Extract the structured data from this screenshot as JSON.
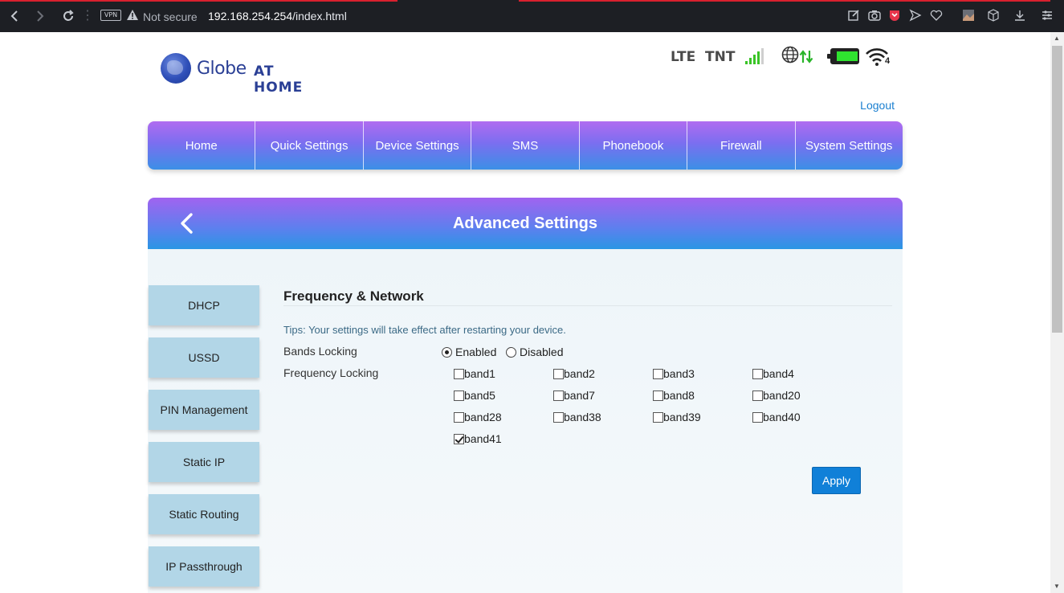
{
  "browser": {
    "vpn_label": "VPN",
    "security_text": "Not secure",
    "url_host": "192.168.254.254",
    "url_path": "/index.html"
  },
  "header": {
    "brand": "Globe",
    "brand_sub": "AT HOME",
    "network_type": "LTE",
    "operator": "TNT",
    "wifi_clients": "4",
    "logout": "Logout"
  },
  "nav": {
    "items": [
      {
        "label": "Home"
      },
      {
        "label": "Quick Settings"
      },
      {
        "label": "Device Settings"
      },
      {
        "label": "SMS"
      },
      {
        "label": "Phonebook"
      },
      {
        "label": "Firewall"
      },
      {
        "label": "System Settings"
      }
    ]
  },
  "section": {
    "title": "Advanced Settings"
  },
  "side_menu": {
    "items": [
      {
        "label": "DHCP"
      },
      {
        "label": "USSD"
      },
      {
        "label": "PIN Management"
      },
      {
        "label": "Static IP"
      },
      {
        "label": "Static Routing"
      },
      {
        "label": "IP Passthrough"
      }
    ]
  },
  "panel": {
    "title": "Frequency & Network",
    "tips": "Tips: Your settings will take effect after restarting your device.",
    "bands_locking_label": "Bands Locking",
    "enabled_label": "Enabled",
    "disabled_label": "Disabled",
    "bands_locking_value": "Enabled",
    "frequency_locking_label": "Frequency Locking",
    "bands": [
      {
        "label": "band1",
        "checked": false
      },
      {
        "label": "band2",
        "checked": false
      },
      {
        "label": "band3",
        "checked": false
      },
      {
        "label": "band4",
        "checked": false
      },
      {
        "label": "band5",
        "checked": false
      },
      {
        "label": "band7",
        "checked": false
      },
      {
        "label": "band8",
        "checked": false
      },
      {
        "label": "band20",
        "checked": false
      },
      {
        "label": "band28",
        "checked": false
      },
      {
        "label": "band38",
        "checked": false
      },
      {
        "label": "band39",
        "checked": false
      },
      {
        "label": "band40",
        "checked": false
      },
      {
        "label": "band41",
        "checked": true
      }
    ],
    "apply_label": "Apply"
  },
  "colors": {
    "accent": "#1080d8",
    "signal": "#3ac427",
    "battery": "#2fe32f",
    "nav_gradient_top": "#b06cf0",
    "nav_gradient_bottom": "#3b8fe6",
    "side_button": "#b2d6e7"
  },
  "icons": {
    "back": "chevron-left-icon",
    "reload": "reload-icon",
    "warning": "warning-icon",
    "globe_network": "globe-icon",
    "data_arrows": "up-down-arrows-icon",
    "battery": "battery-icon",
    "wifi": "wifi-icon",
    "signal": "signal-bars-icon"
  }
}
